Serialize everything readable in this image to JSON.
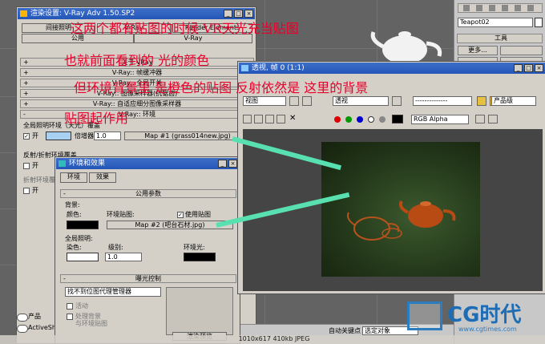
{
  "vray_window": {
    "title": "渲染设置: V-Ray Adv 1.50.SP2",
    "tabs": [
      "间接照明",
      "V-Ray",
      "Render Elements"
    ],
    "subtab": "公用",
    "rollouts": [
      "关于 VRay",
      "V-Ray:: 帧缓冲器",
      "V-Ray:: 全局开关",
      "V-Ray:: 图像采样器(抗锯齿)",
      "V-Ray:: 自适应细分图像采样器",
      "V-Ray:: 环境"
    ],
    "gi_env_label": "全局照明环境（天光）覆盖",
    "on_label": "开",
    "multiplier_label": "倍增器:",
    "multiplier_value": "1.0",
    "map1_button": "Map #1 (grass014new.jpg)",
    "refl_label": "反射/折射环境覆盖",
    "refr_label": "折射环境覆盖",
    "bottom_options": [
      "产品",
      "ActiveShade"
    ]
  },
  "env_window": {
    "title": "环境和效果",
    "tabs": [
      "环境",
      "效果"
    ],
    "section_common": "公用参数",
    "bg_label": "背景:",
    "color_label": "颜色:",
    "envmap_label": "环境贴图:",
    "use_map_label": "使用贴图",
    "map2_button": "Map #2 (吧台石材.jpg)",
    "gl_label": "全局照明:",
    "tint_label": "染色:",
    "level_label": "级别:",
    "level_value": "1.0",
    "ambient_label": "环境光:",
    "exposure_section": "曝光控制",
    "exposure_select": "找不到位图代理管理器",
    "active_label": "活动",
    "process_bg_label": "处理背景",
    "and_env_map": "与环境贴图",
    "render_preview": "渲染预览"
  },
  "render_window": {
    "title": "透视, 帧 0 (1:1)",
    "view_select": "视图",
    "persp_select": "透视",
    "dash_select": "--------------",
    "product_select": "产品级",
    "channel_select": "RGB Alpha"
  },
  "cmd_panel": {
    "object_name": "Teapot02",
    "tools_label": "工具",
    "more_button": "更多...",
    "rows": [
      "",
      "",
      "",
      "",
      "",
      ""
    ]
  },
  "statusbar": {
    "autokey": "自动关键点",
    "selection": "选定对象",
    "info": "1010x617  410kb  JPEG"
  },
  "annotation": {
    "line1": "这两个都有贴图的时候  VR天光充当贴图",
    "line2": "也就前面看到的  光的颜色",
    "line3": "但环境背景里  是橙色的贴图  反射依然是  这里的背景",
    "line4": "贴图起作用"
  },
  "watermark": {
    "brand": "CG时代",
    "url": "www.cgtimes.com"
  },
  "colors": {
    "annotation": "#e8002a",
    "arrow": "#58e0b0",
    "titlebar": "#2456b8"
  }
}
